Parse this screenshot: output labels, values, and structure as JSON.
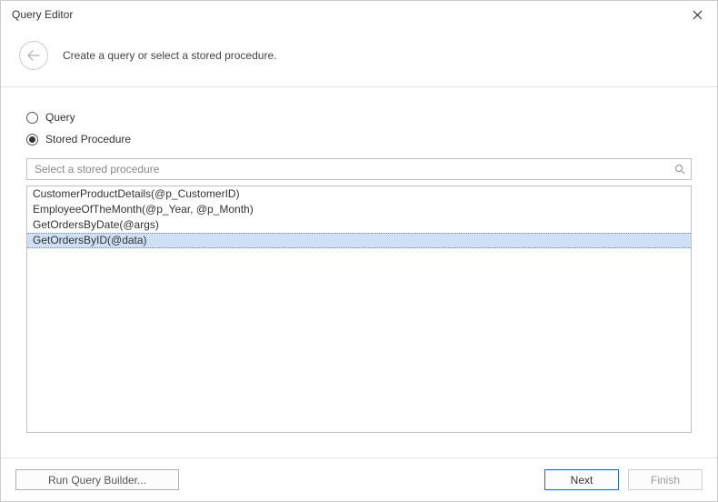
{
  "window": {
    "title": "Query Editor",
    "subtitle": "Create a query or select a stored procedure."
  },
  "radios": {
    "query_label": "Query",
    "stored_label": "Stored Procedure",
    "selected": "stored"
  },
  "search": {
    "placeholder": "Select a stored procedure"
  },
  "list": {
    "items": [
      "CustomerProductDetails(@p_CustomerID)",
      "EmployeeOfTheMonth(@p_Year, @p_Month)",
      "GetOrdersByDate(@args)",
      "GetOrdersByID(@data)"
    ],
    "selected_index": 3
  },
  "footer": {
    "run_label": "Run Query Builder...",
    "next_label": "Next",
    "finish_label": "Finish"
  }
}
